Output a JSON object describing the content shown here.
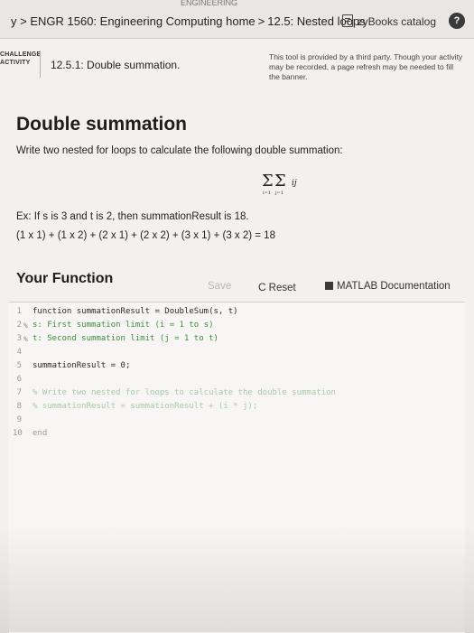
{
  "header": {
    "top_fragment": "ENGINEERING",
    "breadcrumb": {
      "prefix": "y >",
      "course": "ENGR 1560: Engineering Computing home",
      "section": "12.5: Nested loops"
    },
    "catalog_label": "zyBooks catalog",
    "help_label": "?"
  },
  "activity": {
    "tag_line1": "CHALLENGE",
    "tag_line2": "ACTIVITY",
    "title": "12.5.1: Double summation.",
    "third_party_note": "This tool is provided by a third party. Though your activity may be recorded, a page refresh may be needed to fill the banner."
  },
  "content": {
    "title": "Double summation",
    "instruction": "Write two nested for loops to calculate the following double summation:",
    "formula": {
      "outer_sigma": "Σ",
      "inner_sigma": "Σ",
      "outer_limit": "i=1",
      "inner_limit": "j=1",
      "term": "ij"
    },
    "example_line1": "Ex: If s is 3 and t is 2, then summationResult is 18.",
    "example_line2": "(1 x 1) + (1 x 2) + (2 x 1) + (2 x 2) + (3 x 1) + (3 x 2) = 18"
  },
  "function_panel": {
    "heading": "Your Function",
    "save_label": "Save",
    "reset_label": "Reset",
    "reset_icon": "C",
    "doc_label": "MATLAB Documentation"
  },
  "editor": {
    "lines": [
      {
        "num": "1",
        "lock": "",
        "text": "function summationResult = DoubleSum(s, t)",
        "style": "normal"
      },
      {
        "num": "2",
        "lock": "%",
        "text": "s: First summation limit (i = 1 to s)",
        "style": "comment"
      },
      {
        "num": "3",
        "lock": "%",
        "text": "t: Second summation limit (j = 1 to t)",
        "style": "comment"
      },
      {
        "num": "4",
        "lock": "",
        "text": "",
        "style": "normal"
      },
      {
        "num": "5",
        "lock": "",
        "text": "summationResult = 0;",
        "style": "normal"
      },
      {
        "num": "6",
        "lock": "",
        "text": "",
        "style": "normal"
      },
      {
        "num": "7",
        "lock": "",
        "text": "% Write two nested for loops to calculate the double summation",
        "style": "faded"
      },
      {
        "num": "8",
        "lock": "",
        "text": "% summationResult = summationResult + (i * j);",
        "style": "faded"
      },
      {
        "num": "9",
        "lock": "",
        "text": "",
        "style": "normal"
      },
      {
        "num": "10",
        "lock": "",
        "text": "end",
        "style": "end"
      }
    ]
  }
}
